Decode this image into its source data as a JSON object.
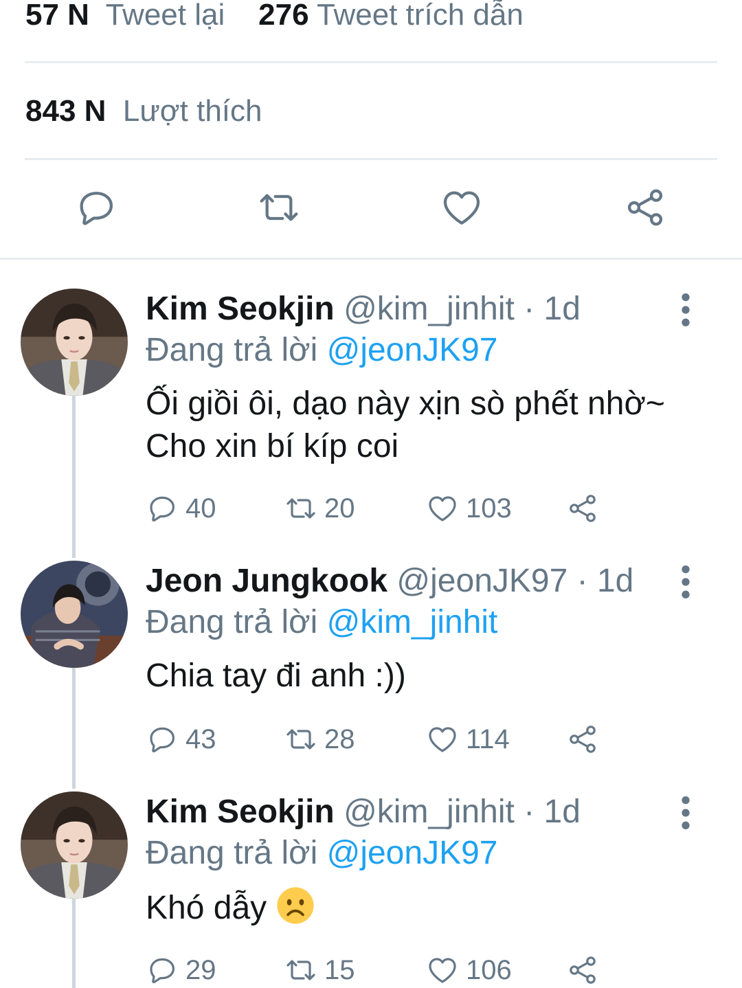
{
  "stats": {
    "retweets_count": "57 N",
    "retweets_label": "Tweet lại",
    "quotes_count": "276",
    "quotes_label": "Tweet trích dẫn",
    "likes_count": "843 N",
    "likes_label": "Lượt thích"
  },
  "colors": {
    "link": "#1da1f2",
    "secondary_text": "#657786",
    "divider": "#e6ecf0"
  },
  "main_actions": [
    "reply-icon",
    "retweet-icon",
    "like-icon",
    "share-icon"
  ],
  "replies": [
    {
      "name": "Kim Seokjin",
      "handle": "@kim_jinhit · 1d",
      "reply_prefix": "Đang trả lời",
      "reply_to": "@jeonJK97",
      "text": "Ối giồi ôi, dạo này xịn sò phết nhờ~ Cho xin bí kíp coi",
      "reply_count": "40",
      "retweet_count": "20",
      "like_count": "103"
    },
    {
      "name": "Jeon Jungkook",
      "handle": "@jeonJK97 · 1d",
      "reply_prefix": "Đang trả lời",
      "reply_to": "@kim_jinhit",
      "text": "Chia tay đi anh :))",
      "reply_count": "43",
      "retweet_count": "28",
      "like_count": "114"
    },
    {
      "name": "Kim Seokjin",
      "handle": "@kim_jinhit · 1d",
      "reply_prefix": "Đang trả lời",
      "reply_to": "@jeonJK97",
      "text": "Khó dẫy",
      "reply_count": "29",
      "retweet_count": "15",
      "like_count": "106"
    }
  ]
}
